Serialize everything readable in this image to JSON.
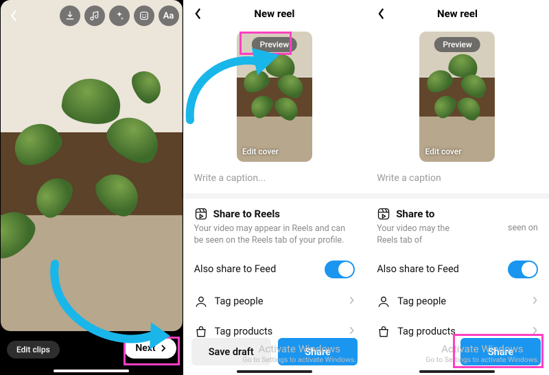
{
  "screen1": {
    "toolbar_icons": [
      "back",
      "download",
      "music",
      "sparkle",
      "sticker",
      "text-aa"
    ],
    "edit_clips_label": "Edit clips",
    "next_label": "Next"
  },
  "screen2": {
    "header_title": "New reel",
    "preview_label": "Preview",
    "edit_cover_label": "Edit cover",
    "caption_placeholder": "Write a caption...",
    "share_section_title": "Share to Reels",
    "share_section_sub": "Your video may appear in Reels and can be seen on the Reels tab of your profile.",
    "also_share_label": "Also share to Feed",
    "also_share_value": true,
    "tag_people_label": "Tag people",
    "tag_products_label": "Tag products",
    "save_draft_label": "Save draft",
    "share_button_label": "Share"
  },
  "screen3": {
    "header_title": "New reel",
    "preview_label": "Preview",
    "edit_cover_label": "Edit cover",
    "caption_placeholder": "Write a caption",
    "share_section_title": "Share to",
    "share_section_sub_left": "Your video may the Reels tab of",
    "share_section_sub_right": "seen on",
    "also_share_label": "Also share to Feed",
    "also_share_value": true,
    "tag_people_label": "Tag people",
    "tag_products_label": "Tag products",
    "share_button_label": "Share"
  },
  "watermark": {
    "line1": "Activate Windows",
    "line2": "Go to Settings to activate Windows."
  },
  "colors": {
    "accent": "#1a96f0",
    "annotation_pink": "#ff3fc2",
    "annotation_blue": "#19b6ea"
  }
}
